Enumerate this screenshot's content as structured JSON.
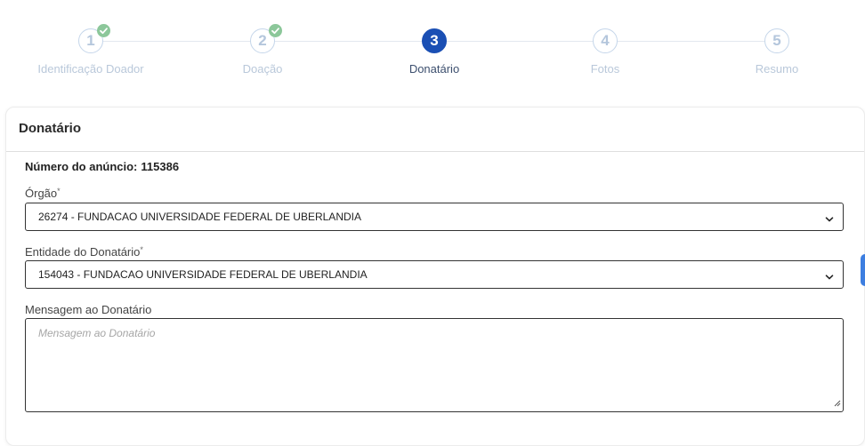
{
  "stepper": {
    "steps": [
      {
        "number": "1",
        "label": "Identificação Doador",
        "status": "completed"
      },
      {
        "number": "2",
        "label": "Doação",
        "status": "completed"
      },
      {
        "number": "3",
        "label": "Donatário",
        "status": "active"
      },
      {
        "number": "4",
        "label": "Fotos",
        "status": "pending"
      },
      {
        "number": "5",
        "label": "Resumo",
        "status": "pending"
      }
    ]
  },
  "card": {
    "title": "Donatário",
    "announcement_label": "Número do anúncio:",
    "announcement_number": "115386",
    "orgao": {
      "label": "Órgão",
      "required_mark": "*",
      "value": "26274 - FUNDACAO UNIVERSIDADE FEDERAL DE UBERLANDIA"
    },
    "entidade": {
      "label": "Entidade do Donatário",
      "required_mark": "*",
      "value": "154043 - FUNDACAO UNIVERSIDADE FEDERAL DE UBERLANDIA"
    },
    "mensagem": {
      "label": "Mensagem ao Donatário",
      "placeholder": "Mensagem ao Donatário",
      "value": ""
    }
  },
  "colors": {
    "active_step": "#1a4fb4",
    "completed_check": "#8cc79a",
    "pending_step": "#c5d6ea",
    "side_tab": "#3d7ee0"
  },
  "icons": {
    "completed_step": "check-icon",
    "select_toggle": "chevron-down-icon",
    "textarea_resize": "resize-handle-icon"
  }
}
